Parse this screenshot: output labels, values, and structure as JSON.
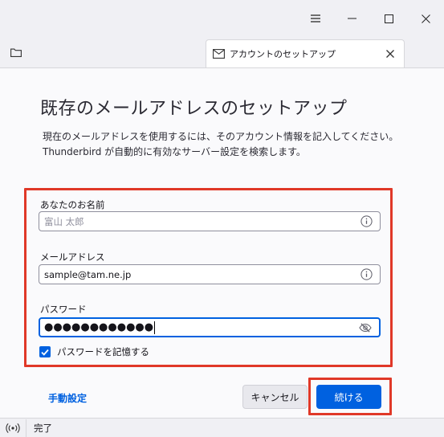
{
  "window": {
    "controls": [
      "menu",
      "minimize",
      "maximize",
      "close"
    ]
  },
  "tabs": [
    {
      "label": "アカウントのセットアップ",
      "icon": "mail-account-icon",
      "active": true
    }
  ],
  "page": {
    "title": "既存のメールアドレスのセットアップ",
    "description_line1": "現在のメールアドレスを使用するには、そのアカウント情報を記入してください。",
    "description_line2": "Thunderbird が自動的に有効なサーバー設定を検索します。"
  },
  "form": {
    "name_label": "あなたのお名前",
    "name_value": "富山 太郎",
    "email_label": "メールアドレス",
    "email_value": "sample@tam.ne.jp",
    "password_label": "パスワード",
    "password_mask": "●●●●●●●●●●●●",
    "remember_label": "パスワードを記憶する",
    "remember_checked": true
  },
  "actions": {
    "manual_config": "手動設定",
    "cancel": "キャンセル",
    "continue": "続ける"
  },
  "status": {
    "text": "完了"
  },
  "colors": {
    "accent": "#0061e0",
    "highlight": "#e03828"
  }
}
